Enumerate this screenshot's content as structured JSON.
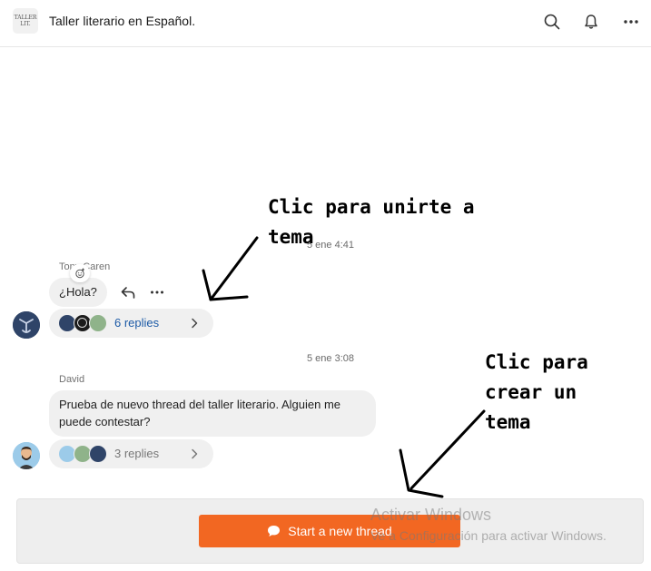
{
  "header": {
    "logo_text": "TALLER LIT.",
    "title": "Taller literario en Español.",
    "icons": [
      "search-icon",
      "bell-icon",
      "more-icon"
    ]
  },
  "thread1": {
    "timestamp": "5 ene 4:41",
    "author": "Tony Caren",
    "message": "¿Hola?",
    "replies_label": "6 replies"
  },
  "thread2": {
    "timestamp": "5 ene 3:08",
    "author": "David",
    "message": "Prueba de nuevo thread del taller literario. Alguien me puede contestar?",
    "replies_label": "3 replies"
  },
  "annotations": {
    "join": [
      "Clic para unirte a",
      "tema"
    ],
    "create": [
      "Clic para",
      "crear un",
      "tema"
    ]
  },
  "footer": {
    "start_thread_label": "Start a new thread"
  },
  "watermark": {
    "line1": "Activar Windows",
    "line2": "Ve a Configuración para activar Windows."
  },
  "colors": {
    "accent": "#f26722",
    "link": "#1c5aa6",
    "bubble": "#f0f0f0"
  }
}
